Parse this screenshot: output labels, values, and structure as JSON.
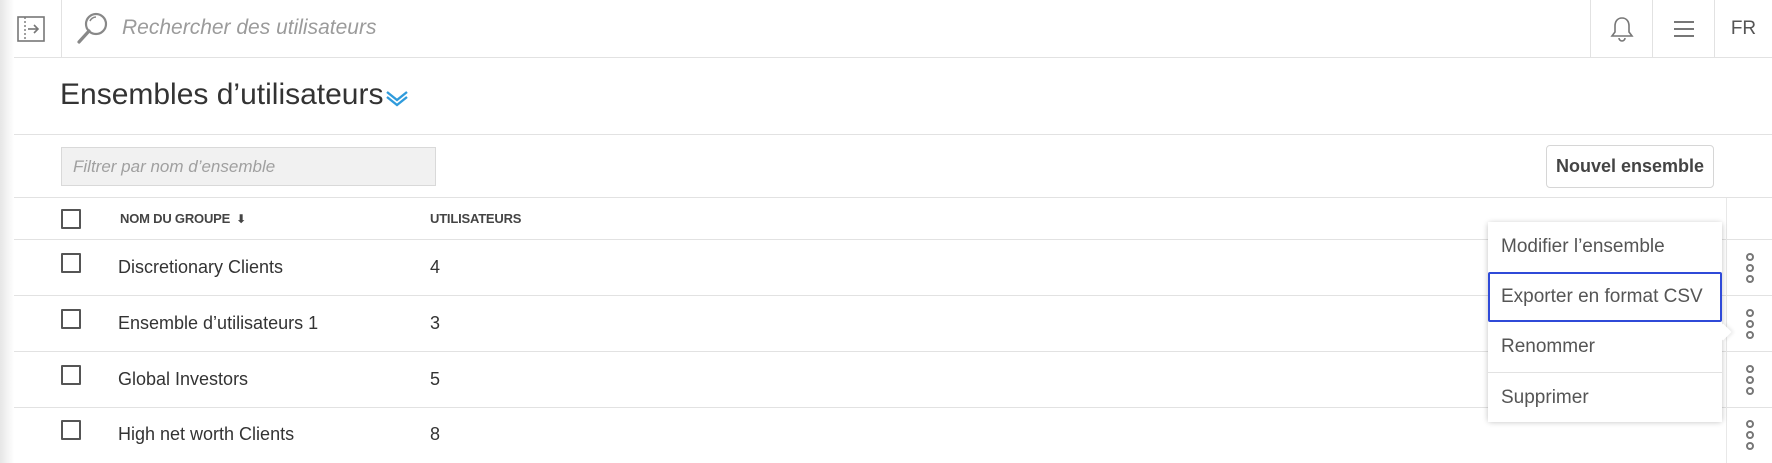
{
  "search": {
    "placeholder": "Rechercher des utilisateurs"
  },
  "topbar": {
    "language": "FR"
  },
  "page": {
    "title": "Ensembles d’utilisateurs"
  },
  "filter": {
    "placeholder": "Filtrer par nom d’ensemble"
  },
  "toolbar": {
    "new_set_label": "Nouvel ensemble"
  },
  "table": {
    "columns": {
      "name": "NOM DU GROUPE",
      "users": "UTILISATEURS"
    },
    "sort_indicator": "⬇",
    "rows": [
      {
        "name": "Discretionary Clients",
        "users": "4"
      },
      {
        "name": "Ensemble d’utilisateurs 1",
        "users": "3"
      },
      {
        "name": "Global Investors",
        "users": "5"
      },
      {
        "name": "High net worth Clients",
        "users": "8"
      }
    ]
  },
  "context_menu": {
    "items": [
      {
        "label": "Modifier l’ensemble"
      },
      {
        "label": "Exporter en format CSV",
        "focused": true
      },
      {
        "label": "Renommer"
      },
      {
        "label": "Supprimer"
      }
    ]
  },
  "icons": {
    "sidebar_toggle": "sidebar-expand-icon",
    "search": "search-icon",
    "notifications": "bell-icon",
    "menu": "hamburger-menu-icon",
    "title_dropdown": "chevron-double-down-icon",
    "row_actions": "kebab-icon"
  },
  "colors": {
    "accent": "#2f9bdc",
    "focus_outline": "#2f4ad8"
  }
}
